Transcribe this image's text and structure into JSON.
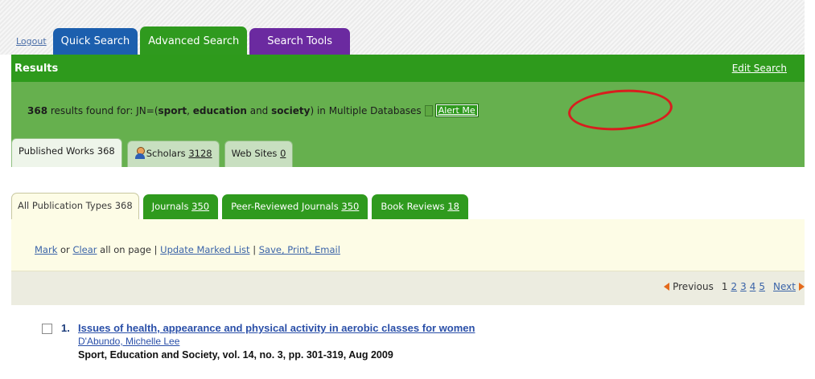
{
  "header": {
    "logout": "Logout",
    "tabs": [
      {
        "label": "Quick Search",
        "color": "#1c5fae"
      },
      {
        "label": "Advanced Search",
        "color": "#2f9a1e"
      },
      {
        "label": "Search Tools",
        "color": "#6b2aa0"
      }
    ]
  },
  "results_bar": {
    "title": "Results",
    "edit_search": "Edit Search"
  },
  "summary": {
    "count": "368",
    "found_for": " results found for: JN=(",
    "term1": "sport",
    "sep1": ", ",
    "term2": "education",
    "and": " and ",
    "term3": "society",
    "close_paren": ")",
    "scope": " in Multiple Databases",
    "alert_me": "Alert Me"
  },
  "source_tabs": [
    {
      "label": "Published Works 368",
      "count": ""
    },
    {
      "label": "Scholars ",
      "count": "3128"
    },
    {
      "label": "Web Sites ",
      "count": "0"
    }
  ],
  "pub_tabs": [
    {
      "label": "All Publication Types 368",
      "count": ""
    },
    {
      "label": "Journals ",
      "count": "350"
    },
    {
      "label": "Peer-Reviewed Journals ",
      "count": "350"
    },
    {
      "label": "Book Reviews ",
      "count": "18"
    }
  ],
  "mark_bar": {
    "mark": "Mark",
    "or": " or ",
    "clear": "Clear",
    "all_on_page": " all on page | ",
    "update": "Update Marked List",
    "sep": " | ",
    "save": "Save, Print, Email"
  },
  "pager": {
    "previous": "Previous",
    "current": "1",
    "pages": [
      "2",
      "3",
      "4",
      "5"
    ],
    "next": "Next"
  },
  "results": [
    {
      "number": "1.",
      "title": "Issues of health, appearance and physical activity in aerobic classes for women",
      "author": "D'Abundo, Michelle Lee",
      "source": "Sport, Education and Society, vol. 14, no. 3, pp. 301-319, Aug 2009"
    }
  ]
}
